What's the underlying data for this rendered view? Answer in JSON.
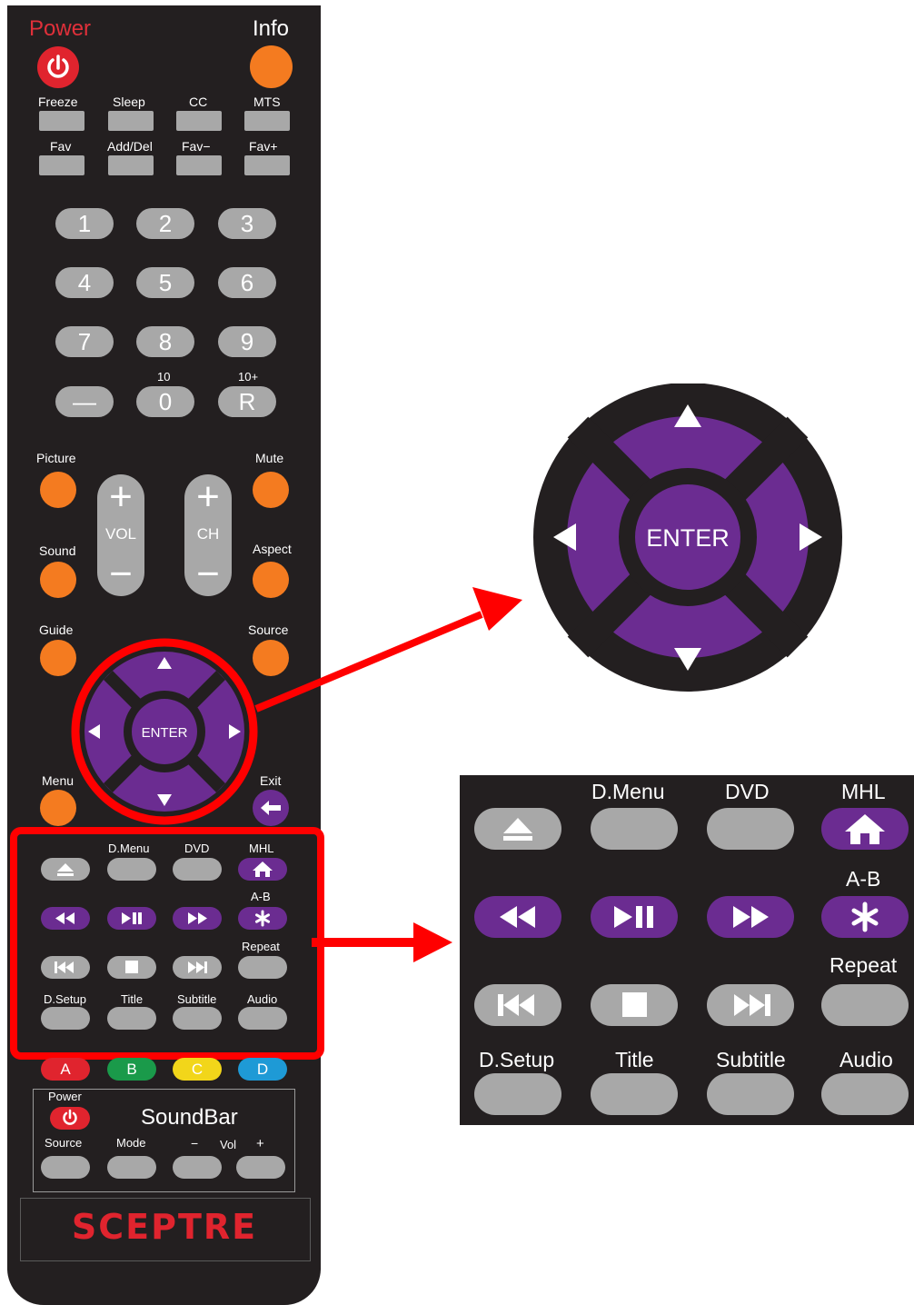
{
  "top": {
    "power_label": "Power",
    "info_label": "Info"
  },
  "row1": [
    "Freeze",
    "Sleep",
    "CC",
    "MTS"
  ],
  "row2": [
    "Fav",
    "Add/Del",
    "Fav−",
    "Fav+"
  ],
  "numpad": [
    "1",
    "2",
    "3",
    "4",
    "5",
    "6",
    "7",
    "8",
    "9",
    "—",
    "0",
    "R"
  ],
  "numpad_sublabels": {
    "zero": "10",
    "r": "10+"
  },
  "side": {
    "picture": "Picture",
    "mute": "Mute",
    "sound": "Sound",
    "aspect": "Aspect",
    "guide": "Guide",
    "source": "Source",
    "menu": "Menu",
    "exit": "Exit"
  },
  "rockers": {
    "vol": "VOL",
    "ch": "CH"
  },
  "dpad": {
    "enter": "ENTER"
  },
  "media_labels": {
    "dmenu": "D.Menu",
    "dvd": "DVD",
    "mhl": "MHL",
    "ab": "A-B",
    "repeat": "Repeat",
    "dsetup": "D.Setup",
    "title": "Title",
    "subtitle": "Subtitle",
    "audio": "Audio"
  },
  "color_buttons": [
    "A",
    "B",
    "C",
    "D"
  ],
  "color_values": {
    "a": "#e0242e",
    "b": "#1a9a4a",
    "c": "#f2d61a",
    "d": "#1e9ad6",
    "purple": "#6b2c91",
    "orange": "#f47b20",
    "red": "#ff0000"
  },
  "soundbar": {
    "power": "Power",
    "title": "SoundBar",
    "source": "Source",
    "mode": "Mode",
    "minus": "−",
    "vol": "Vol",
    "plus": "+"
  },
  "brand": "SCEPTRE"
}
